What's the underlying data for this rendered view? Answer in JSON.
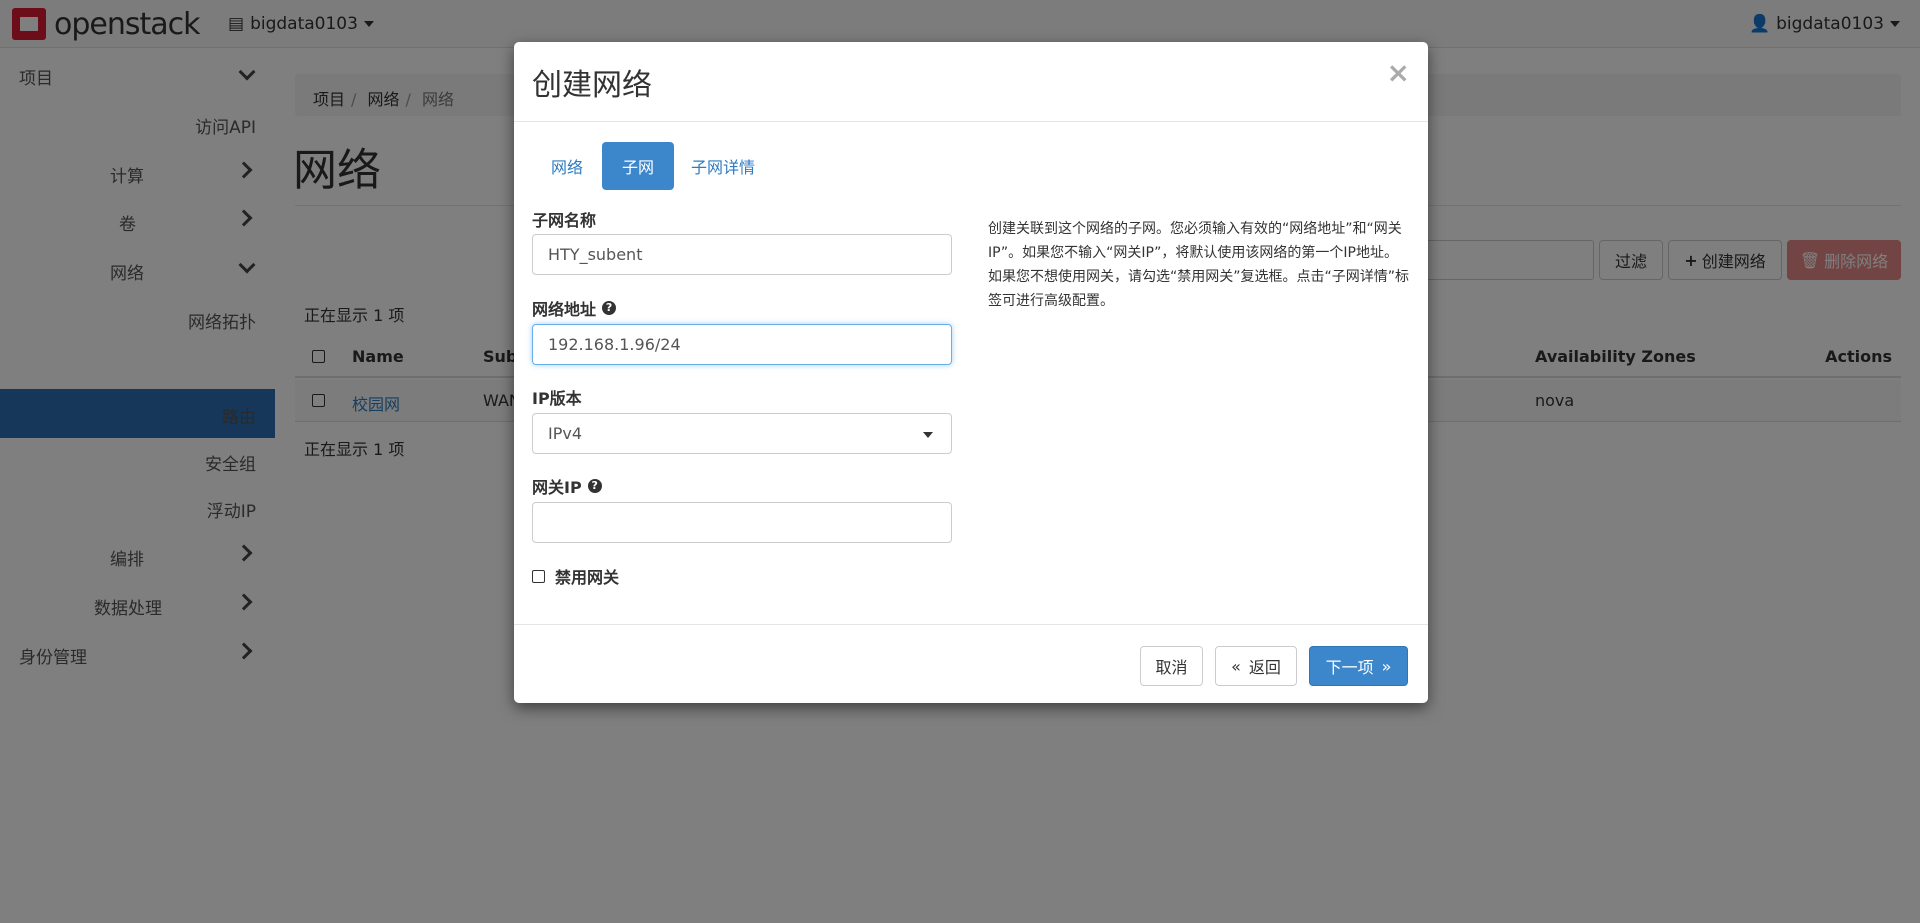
{
  "navbar": {
    "brand": "openstack",
    "project": "bigdata0103",
    "user": "bigdata0103"
  },
  "sidebar": {
    "items": [
      {
        "label": "项目"
      },
      {
        "label": "访问API"
      },
      {
        "label": "计算"
      },
      {
        "label": "卷"
      },
      {
        "label": "网络"
      },
      {
        "label": "网络拓扑"
      },
      {
        "label": "网络"
      },
      {
        "label": "路由"
      },
      {
        "label": "安全组"
      },
      {
        "label": "浮动IP"
      },
      {
        "label": "编排"
      },
      {
        "label": "数据处理"
      },
      {
        "label": "身份管理"
      }
    ],
    "active_color": "#2d6eb5"
  },
  "main": {
    "breadcrumb": [
      "项目",
      "网络",
      "网络"
    ],
    "title": "网络",
    "filter_label": "过滤",
    "create_label": "创建网络",
    "delete_label": "删除网络",
    "showing_top": "正在显示 1 项",
    "showing_bottom": "正在显示 1 项",
    "columns": {
      "name": "Name",
      "subnets": "Sub",
      "zones": "Availability Zones",
      "actions": "Actions"
    },
    "rows": [
      {
        "name": "校园网",
        "subnets": "WAN",
        "zones": "nova"
      }
    ]
  },
  "modal": {
    "title": "创建网络",
    "close": "×",
    "tabs": [
      {
        "label": "网络"
      },
      {
        "label": "子网"
      },
      {
        "label": "子网详情"
      }
    ],
    "subnet_name_label": "子网名称",
    "subnet_name_value": "HTY_subent",
    "address_label": "网络地址",
    "address_value": "192.168.1.96/24",
    "ip_version_label": "IP版本",
    "ip_version_value": "IPv4",
    "gateway_label": "网关IP",
    "gateway_value": "",
    "disable_gateway_label": "禁用网关",
    "help_text": "创建关联到这个网络的子网。您必须输入有效的“网络地址”和“网关IP”。如果您不输入“网关IP”，将默认使用该网络的第一个IP地址。如果您不想使用网关，请勾选“禁用网关”复选框。点击“子网详情”标签可进行高级配置。",
    "cancel_label": "取消",
    "back_label": "返回",
    "next_label": "下一项",
    "primary_color": "#3c87cc"
  }
}
